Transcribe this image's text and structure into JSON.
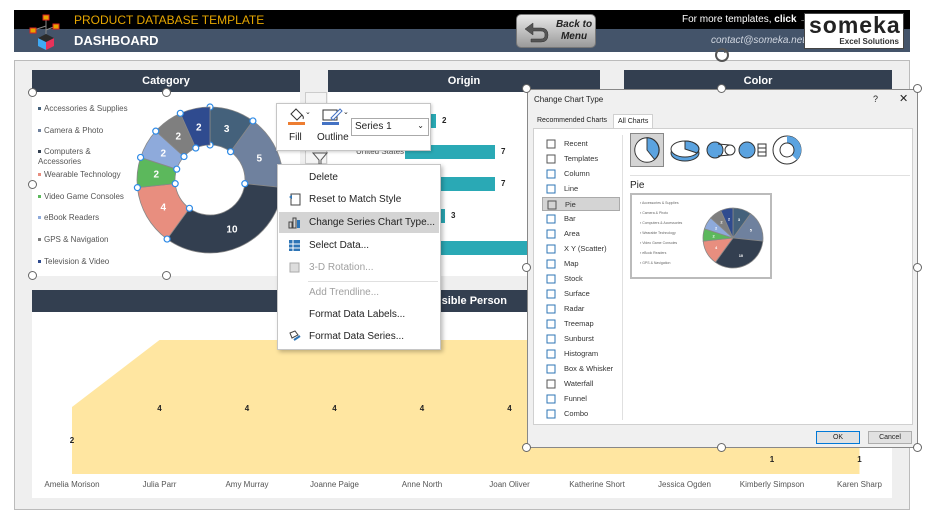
{
  "header": {
    "title": "PRODUCT DATABASE TEMPLATE",
    "subtitle": "DASHBOARD",
    "back_button": "Back to Menu",
    "back_line1": "Back to",
    "back_line2": "Menu",
    "more_templates_prefix": "For more templates, ",
    "more_templates_click": "click →",
    "contact": "contact@someka.net",
    "brand": "someka",
    "brand_tagline": "Excel Solutions"
  },
  "panels": {
    "category": "Category",
    "origin": "Origin",
    "color": "Color",
    "responsible": "Responsible Person",
    "responsible_visible": "onsible Person"
  },
  "category_chart": {
    "type": "doughnut",
    "legend": [
      {
        "label": "Accessories & Supplies",
        "color": "#44617b"
      },
      {
        "label": "Camera & Photo",
        "color": "#6f819e"
      },
      {
        "label": "Computers & Accessories",
        "color": "#333f50"
      },
      {
        "label": "Wearable Technology",
        "color": "#e88e7f"
      },
      {
        "label": "Video Game Consoles",
        "color": "#5cb85c"
      },
      {
        "label": "eBook Readers",
        "color": "#8eaadb"
      },
      {
        "label": "GPS & Navigation",
        "color": "#7f7f7f"
      },
      {
        "label": "Television & Video",
        "color": "#2f4b8f"
      }
    ],
    "values": [
      3,
      5,
      10,
      4,
      2,
      2,
      2,
      2
    ]
  },
  "origin_chart": {
    "visible_label": "United States",
    "values": [
      2,
      7,
      7,
      3
    ]
  },
  "mini_toolbar": {
    "fill": "Fill",
    "outline": "Outline",
    "series_select": "Series 1"
  },
  "context_menu": {
    "items": [
      {
        "label": "Delete",
        "disabled": false
      },
      {
        "label": "Reset to Match Style",
        "disabled": false
      },
      {
        "label": "Change Series Chart Type...",
        "disabled": false,
        "highlighted": true
      },
      {
        "label": "Select Data...",
        "disabled": false
      },
      {
        "label": "3-D Rotation...",
        "disabled": true
      },
      {
        "label": "Add Trendline...",
        "disabled": true
      },
      {
        "label": "Format Data Labels...",
        "disabled": false
      },
      {
        "label": "Format Data Series...",
        "disabled": false
      }
    ]
  },
  "dialog": {
    "title": "Change Chart Type",
    "help": "?",
    "close": "✕",
    "tabs": [
      "Recommended Charts",
      "All Charts"
    ],
    "active_tab": "All Charts",
    "chart_types": [
      "Recent",
      "Templates",
      "Column",
      "Line",
      "Pie",
      "Bar",
      "Area",
      "X Y (Scatter)",
      "Map",
      "Stock",
      "Surface",
      "Radar",
      "Treemap",
      "Sunburst",
      "Histogram",
      "Box & Whisker",
      "Waterfall",
      "Funnel",
      "Combo"
    ],
    "selected_type": "Pie",
    "section_title": "Pie",
    "ok": "OK",
    "cancel": "Cancel"
  },
  "chart_data": {
    "type": "area",
    "title": "Responsible Person",
    "categories": [
      "Amelia Morison",
      "Julia Parr",
      "Amy Murray",
      "Joanne Paige",
      "Anne North",
      "Joan Oliver",
      "Katherine Short",
      "Jessica Ogden",
      "Kimberly Simpson",
      "Karen Sharp"
    ],
    "series": [
      {
        "name": "Series 1",
        "values": [
          2,
          4,
          4,
          4,
          4,
          4,
          null,
          null,
          1,
          1
        ]
      }
    ],
    "ylim": [
      0,
      5
    ],
    "color": "#ffe6a1"
  }
}
